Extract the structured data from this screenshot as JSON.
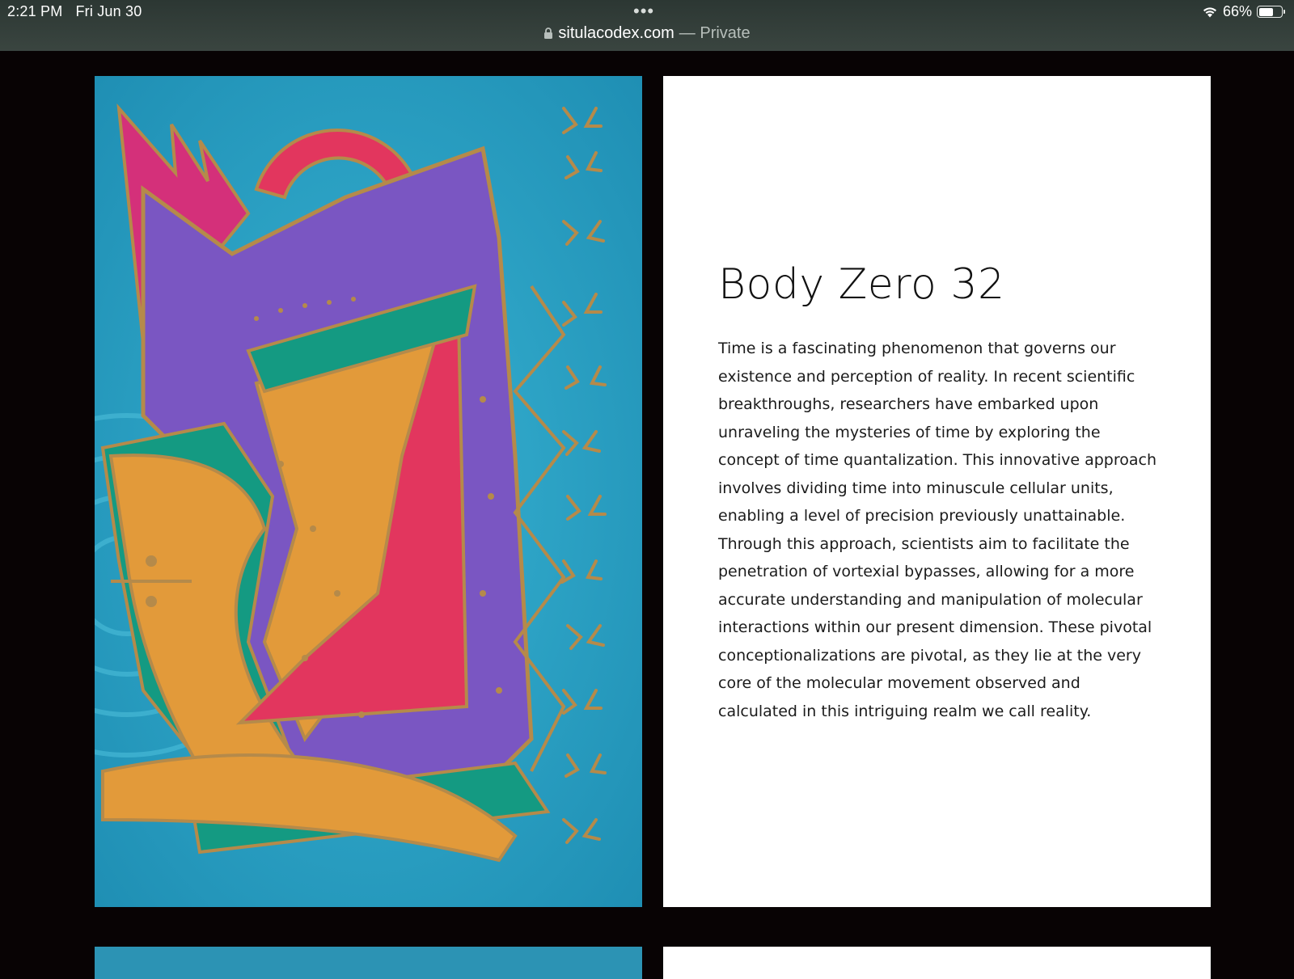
{
  "status_bar": {
    "time": "2:21 PM",
    "date": "Fri Jun 30",
    "battery_percent": "66%",
    "battery_level": 0.66
  },
  "address_bar": {
    "domain": "situlacodex.com",
    "suffix": "— Private",
    "icon": "lock-icon"
  },
  "article": {
    "title": "Body Zero 32",
    "body": "Time is a fascinating phenomenon that governs our existence and perception of reality. In recent scientific breakthroughs, researchers have embarked upon unraveling the mysteries of time by exploring the concept of time quantalization. This innovative approach involves dividing time into minuscule cellular units, enabling a level of precision previously unattainable. Through this approach, scientists aim to facilitate the penetration of vortexial bypasses, allowing for a more accurate understanding and manipulation of molecular interactions within our present dimension. These pivotal conceptionalizations are pivotal, as they lie at the very core of the molecular movement observed and calculated in this intriguing realm we call reality."
  },
  "colors": {
    "page_background": "#080304",
    "art_blue": "#2fa4c4",
    "art_purple": "#7a56c2",
    "art_orange": "#e29a3a",
    "art_red": "#e2365e",
    "art_green": "#149a82",
    "art_gold_outline": "#b58a4a"
  }
}
